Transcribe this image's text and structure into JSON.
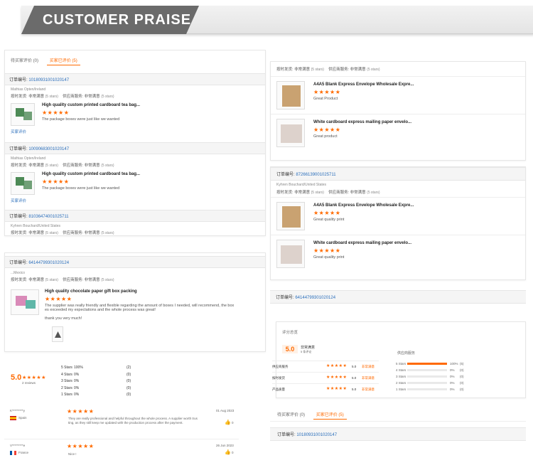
{
  "banner": {
    "title": "CUSTOMER  PRAISE"
  },
  "left": {
    "tabs": [
      "待买家评价 (0)",
      "买家已评价 (5)"
    ],
    "orders": [
      {
        "label": "订单编号:",
        "number": "10180931001020147",
        "buyer": "Mathias Opten/Ireland",
        "ship_label": "按时发货:",
        "ship_value": "非常满意",
        "ship_stars": "(5 stars)",
        "service_label": "供应商服务:",
        "service_value": "非常满意",
        "service_stars": "(5 stars)",
        "product": "High quality custom printed cardboard tea bag...",
        "stars": "★★★★★",
        "comment": "The package boxes were just like we wanted",
        "link": "买家评价"
      },
      {
        "label": "订单编号:",
        "number": "10090683001020147",
        "buyer": "Mathias Opten/Ireland",
        "ship_label": "按时发货:",
        "ship_value": "非常满意",
        "ship_stars": "(5 stars)",
        "service_label": "供应商服务:",
        "service_value": "非常满意",
        "service_stars": "(5 stars)",
        "product": "High quality custom printed cardboard tea bag...",
        "stars": "★★★★★",
        "comment": "The package boxes were just like we wanted",
        "link": "买家评价"
      },
      {
        "label": "订单编号:",
        "number": "81036474001025711",
        "buyer": "Kyhren Bouchard/United States",
        "ship_label": "按时发货:",
        "ship_value": "非常满意",
        "ship_stars": "(5 stars)",
        "service_label": "供应商服务:",
        "service_value": "非常满意",
        "service_stars": "(5 stars)"
      }
    ],
    "order4": {
      "label": "订单编号:",
      "number": "64144799301020124",
      "buyer": "...Mexico",
      "ship_label": "按时发货:",
      "ship_value": "非常满意",
      "ship_stars": "(5 stars)",
      "service_label": "供应商服务:",
      "service_value": "非常满意",
      "service_stars": "(5 stars)",
      "product": "High quality chocolate paper gift box packing",
      "stars": "★★★★★",
      "comment_1": "The supplier was really friendly and flexible regarding the amount of boxes I needed, will recommend, the box",
      "comment_2": "es exceeded my expectations and the whole process was great!",
      "comment_3": "thank you very much!"
    },
    "summary": {
      "score": "5.0",
      "stars": "★★★★★",
      "reviews": "2 reviews",
      "rows": [
        {
          "label": "5 Stars",
          "pct": "100%",
          "count": "(2)"
        },
        {
          "label": "4 Stars",
          "pct": "0%",
          "count": "(0)"
        },
        {
          "label": "3 Stars",
          "pct": "0%",
          "count": "(0)"
        },
        {
          "label": "2 Stars",
          "pct": "0%",
          "count": "(0)"
        },
        {
          "label": "1 Stars",
          "pct": "0%",
          "count": "(0)"
        }
      ]
    },
    "reviews": [
      {
        "name": "K*********y",
        "country": "Spain",
        "stars": "★★★★★",
        "date": "01 Aug 2023",
        "text_1": "They are really professional and helpful throughout the whole process. A supplier worth trus",
        "text_2": "ting, as they still keep me updated with the production process after the payment.",
        "likes": "0"
      },
      {
        "name": "V*********e",
        "country": "France",
        "stars": "★★★★★",
        "date": "26 Jun 2023",
        "text_1": "Nice !",
        "likes": "0"
      }
    ]
  },
  "right": {
    "top_rating": {
      "ship_label": "按时发货:",
      "ship_value": "非常满意",
      "ship_stars": "(5 stars)",
      "service_label": "供应商服务:",
      "service_value": "非常满意",
      "service_stars": "(5 stars)"
    },
    "items_a": [
      {
        "product": "A4A5 Blank Express Envelope Wholesale Expre...",
        "stars": "★★★★★",
        "comment": "Great Product"
      },
      {
        "product": "White cardboard express mailing paper envelo...",
        "stars": "★★★★★",
        "comment": "Great product"
      }
    ],
    "order2": {
      "label": "订单编号:",
      "number": "87266139001025711",
      "buyer": "Kyhren Bouchard/United States",
      "ship_label": "按时发货:",
      "ship_value": "非常满意",
      "ship_stars": "(5 stars)",
      "service_label": "供应商服务:",
      "service_value": "非常满意",
      "service_stars": "(5 stars)"
    },
    "items_b": [
      {
        "product": "A4A5 Blank Express Envelope Wholesale Expre...",
        "stars": "★★★★★",
        "comment": "Great quality print"
      },
      {
        "product": "White cardboard express mailing paper envelo...",
        "stars": "★★★★★",
        "comment": "Great quality print"
      }
    ],
    "order3": {
      "label": "订单编号:",
      "number": "64144799301020124"
    },
    "rating_panel": {
      "title": "评分总览",
      "score": "5.0",
      "score_label": "非常满意",
      "score_sub": "5 条评论",
      "rows": [
        {
          "label": "供应商服务",
          "stars": "★★★★★",
          "score": "5.0",
          "tag": "非常满意"
        },
        {
          "label": "按时发货",
          "stars": "★★★★★",
          "score": "5.0",
          "tag": "非常满意"
        },
        {
          "label": "产品质量",
          "stars": "★★★★★",
          "score": "5.0",
          "tag": "非常满意"
        }
      ],
      "dist_title": "供应商服务",
      "dist": [
        {
          "label": "5 Stars",
          "pct": "100%",
          "count": "(5)",
          "fill": 1.0
        },
        {
          "label": "4 Stars",
          "pct": "0%",
          "count": "(0)",
          "fill": 0
        },
        {
          "label": "3 Stars",
          "pct": "0%",
          "count": "(0)",
          "fill": 0
        },
        {
          "label": "2 Stars",
          "pct": "0%",
          "count": "(0)",
          "fill": 0
        },
        {
          "label": "1 Stars",
          "pct": "0%",
          "count": "(0)",
          "fill": 0
        }
      ]
    },
    "bottom_tabs": [
      "待买家评价 (0)",
      "买家已评价 (5)"
    ],
    "bottom_order": {
      "label": "订单编号:",
      "number": "10180931001020147"
    }
  }
}
